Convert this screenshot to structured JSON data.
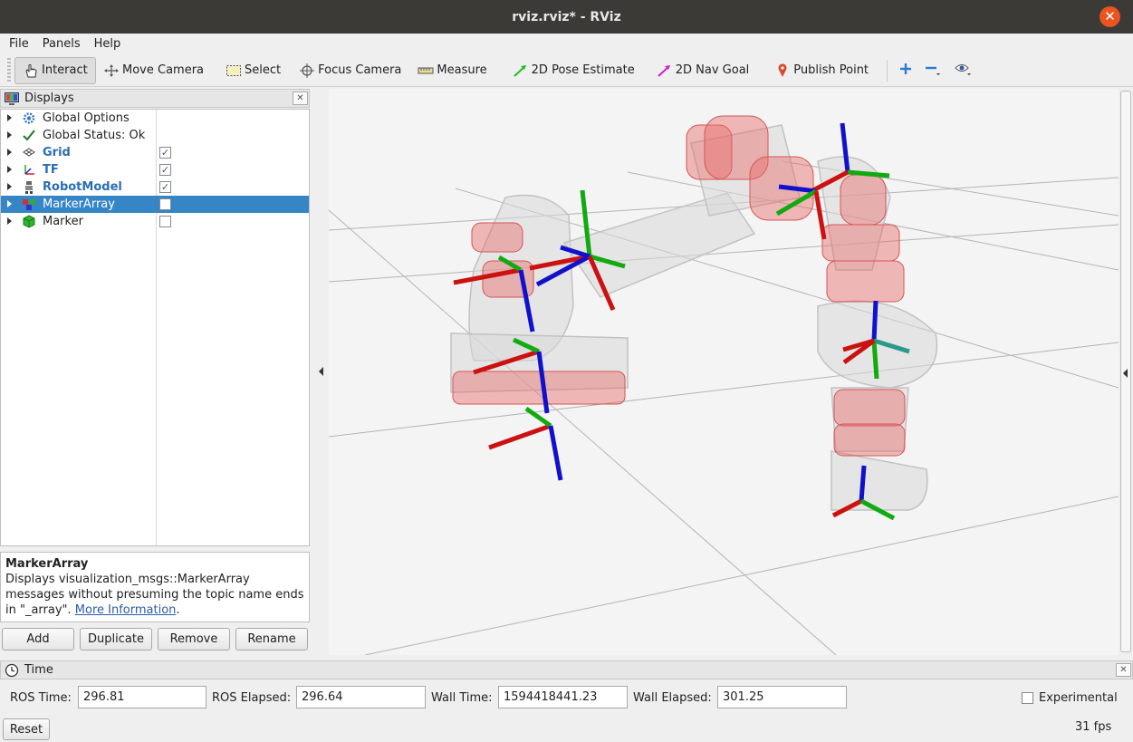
{
  "window": {
    "title": "rviz.rviz* - RViz",
    "close_glyph": "✕"
  },
  "menu": [
    "File",
    "Panels",
    "Help"
  ],
  "toolbar": {
    "tools": [
      {
        "label": "Interact",
        "icon": "hand-pointer-icon"
      },
      {
        "label": "Move Camera",
        "icon": "move-camera-icon"
      },
      {
        "label": "Select",
        "icon": "select-rectangle-icon"
      },
      {
        "label": "Focus Camera",
        "icon": "focus-crosshair-icon"
      },
      {
        "label": "Measure",
        "icon": "ruler-icon"
      },
      {
        "label": "2D Pose Estimate",
        "icon": "green-arrow-icon"
      },
      {
        "label": "2D Nav Goal",
        "icon": "magenta-arrow-icon"
      },
      {
        "label": "Publish Point",
        "icon": "map-pin-icon"
      }
    ],
    "active_tool": "Interact",
    "extra_icons": [
      "plus-icon",
      "minus-icon",
      "eye-icon"
    ]
  },
  "displays": {
    "title": "Displays",
    "items": [
      {
        "label": "Global Options",
        "icon": "gear-icon",
        "bold": false,
        "checkbox": null,
        "selected": false
      },
      {
        "label": "Global Status: Ok",
        "icon": "checkmark-icon",
        "bold": false,
        "checkbox": null,
        "selected": false
      },
      {
        "label": "Grid",
        "icon": "grid-icon",
        "bold": true,
        "checkbox": true,
        "selected": false
      },
      {
        "label": "TF",
        "icon": "tf-axes-icon",
        "bold": true,
        "checkbox": true,
        "selected": false
      },
      {
        "label": "RobotModel",
        "icon": "robot-icon",
        "bold": true,
        "checkbox": true,
        "selected": false
      },
      {
        "label": "MarkerArray",
        "icon": "marker-array-icon",
        "bold": false,
        "checkbox": false,
        "selected": true
      },
      {
        "label": "Marker",
        "icon": "green-cube-icon",
        "bold": false,
        "checkbox": false,
        "selected": false
      }
    ],
    "description": {
      "title": "MarkerArray",
      "text": "Displays visualization_msgs::MarkerArray messages without presuming the topic name ends in \"_array\". ",
      "link": "More Information",
      "suffix": "."
    },
    "buttons": [
      "Add",
      "Duplicate",
      "Remove",
      "Rename"
    ]
  },
  "time": {
    "title": "Time",
    "ros_time_label": "ROS Time:",
    "ros_time": "296.81",
    "ros_elapsed_label": "ROS Elapsed:",
    "ros_elapsed": "296.64",
    "wall_time_label": "Wall Time:",
    "wall_time": "1594418441.23",
    "wall_elapsed_label": "Wall Elapsed:",
    "wall_elapsed": "301.25",
    "experimental_label": "Experimental",
    "experimental_checked": false,
    "reset_label": "Reset",
    "fps": "31 fps"
  },
  "colors": {
    "titlebar": "#3b3a37",
    "close": "#e95420",
    "selection": "#3585c7",
    "axis_x": "#cc1111",
    "axis_y": "#11aa11",
    "axis_z": "#1111cc",
    "marker": "#e86a6a"
  }
}
